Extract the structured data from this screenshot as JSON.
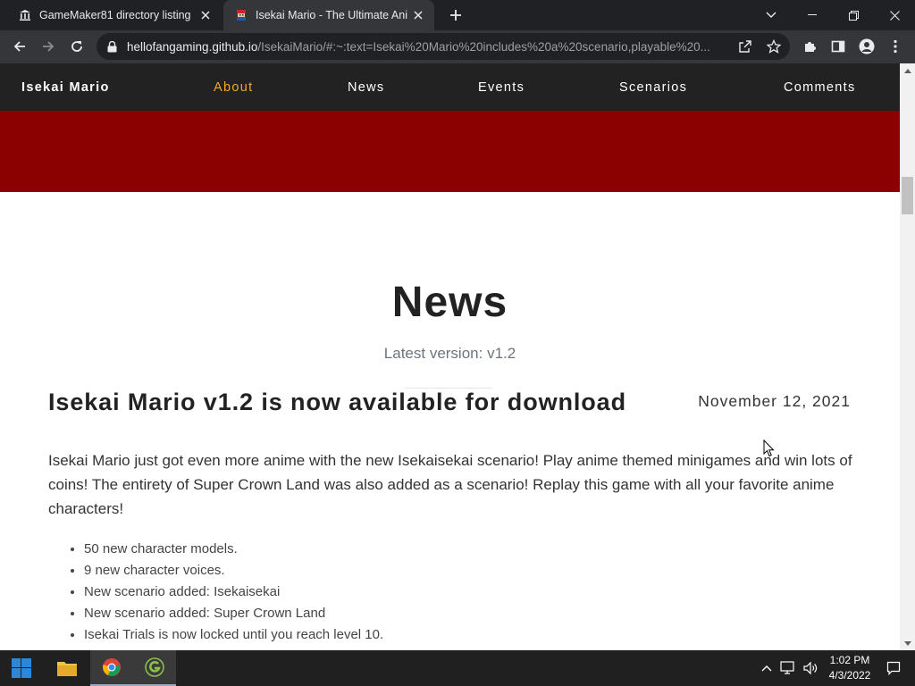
{
  "browser": {
    "tabs": [
      {
        "title": "GameMaker81 directory listing",
        "icon": "museum-icon"
      },
      {
        "title": "Isekai Mario - The Ultimate Anim",
        "icon": "site-favicon"
      }
    ],
    "url_host": "hellofangaming.github.io",
    "url_path": "/IsekaiMario/#:~:text=Isekai%20Mario%20includes%20a%20scenario,playable%20..."
  },
  "site": {
    "brand": "Isekai Mario",
    "nav": [
      {
        "label": "About",
        "active": true
      },
      {
        "label": "News",
        "active": false
      },
      {
        "label": "Events",
        "active": false
      },
      {
        "label": "Scenarios",
        "active": false
      },
      {
        "label": "Comments",
        "active": false
      }
    ],
    "colors": {
      "nav_bg": "#222222",
      "hero": "#8b0000",
      "active_link": "#f5a623"
    }
  },
  "news": {
    "heading": "News",
    "subheading": "Latest version: v1.2",
    "post": {
      "title": "Isekai Mario v1.2 is now available for download",
      "date": "November 12, 2021",
      "body": "Isekai Mario just got even more anime with the new Isekaisekai scenario! Play anime themed minigames and win lots of coins! The entirety of Super Crown Land was also added as a scenario! Replay this game with all your favorite anime characters!",
      "items": [
        "50 new character models.",
        "9 new character voices.",
        "New scenario added: Isekaisekai",
        "New scenario added: Super Crown Land",
        "Isekai Trials is now locked until you reach level 10."
      ]
    }
  },
  "taskbar": {
    "apps": [
      "windows-start",
      "file-explorer",
      "chrome",
      "gamemaker"
    ],
    "time": "1:02 PM",
    "date": "4/3/2022"
  }
}
